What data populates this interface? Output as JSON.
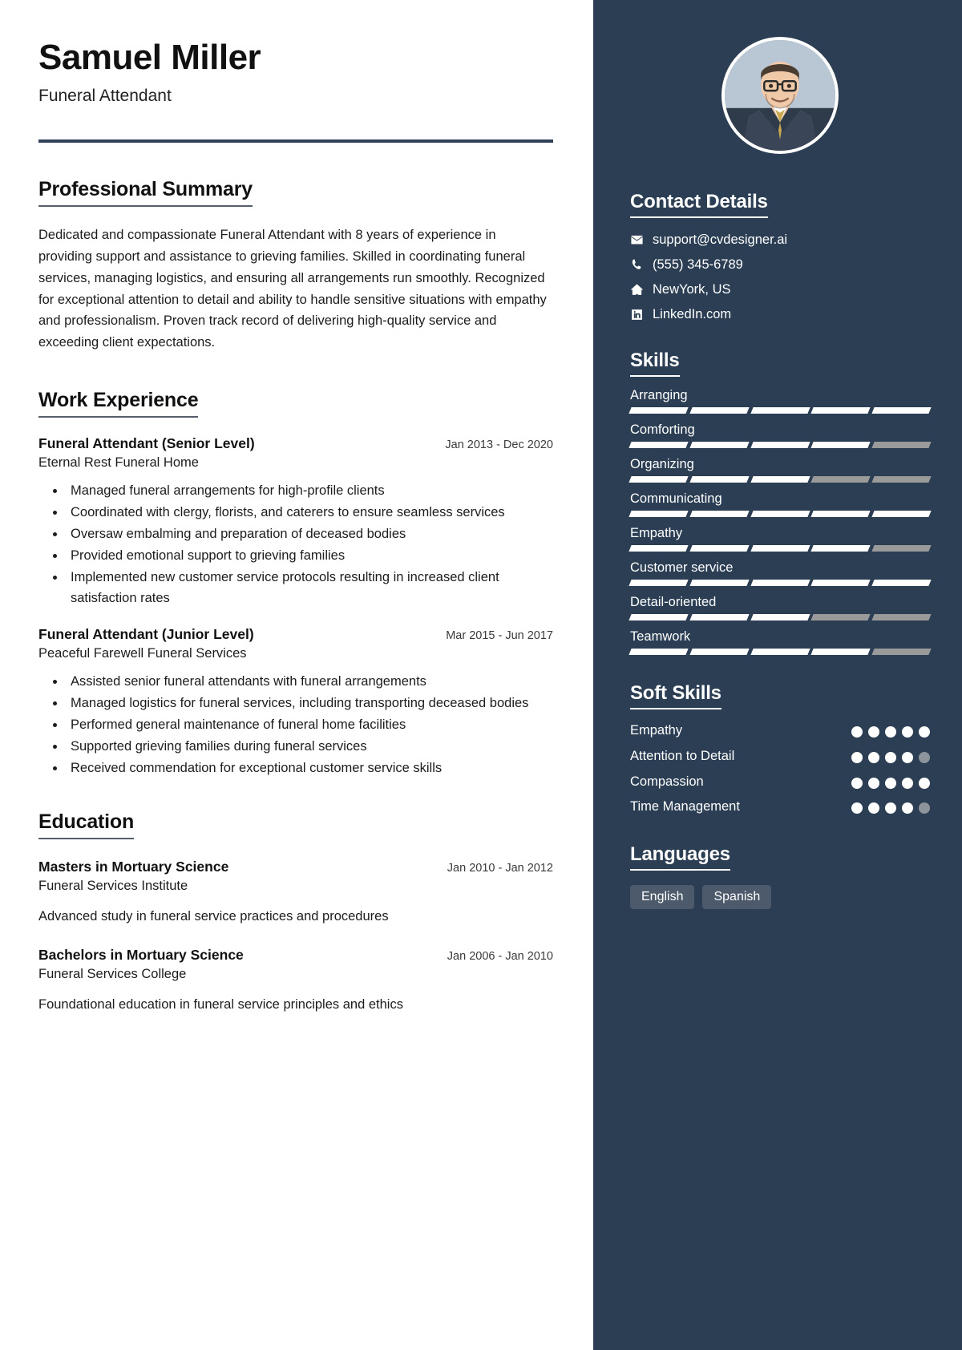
{
  "header": {
    "name": "Samuel Miller",
    "job_title": "Funeral Attendant"
  },
  "summary": {
    "heading": "Professional Summary",
    "text": "Dedicated and compassionate Funeral Attendant with 8 years of experience in providing support and assistance to grieving families. Skilled in coordinating funeral services, managing logistics, and ensuring all arrangements run smoothly. Recognized for exceptional attention to detail and ability to handle sensitive situations with empathy and professionalism. Proven track record of delivering high-quality service and exceeding client expectations."
  },
  "work": {
    "heading": "Work Experience",
    "entries": [
      {
        "role": "Funeral Attendant (Senior Level)",
        "date": "Jan 2013 - Dec 2020",
        "org": "Eternal Rest Funeral Home",
        "bullets": [
          "Managed funeral arrangements for high-profile clients",
          "Coordinated with clergy, florists, and caterers to ensure seamless services",
          "Oversaw embalming and preparation of deceased bodies",
          "Provided emotional support to grieving families",
          "Implemented new customer service protocols resulting in increased client satisfaction rates"
        ]
      },
      {
        "role": "Funeral Attendant (Junior Level)",
        "date": "Mar 2015 - Jun 2017",
        "org": "Peaceful Farewell Funeral Services",
        "bullets": [
          "Assisted senior funeral attendants with funeral arrangements",
          "Managed logistics for funeral services, including transporting deceased bodies",
          "Performed general maintenance of funeral home facilities",
          "Supported grieving families during funeral services",
          "Received commendation for exceptional customer service skills"
        ]
      }
    ]
  },
  "education": {
    "heading": "Education",
    "entries": [
      {
        "degree": "Masters in Mortuary Science",
        "date": "Jan 2010 - Jan 2012",
        "school": "Funeral Services Institute",
        "description": "Advanced study in funeral service practices and procedures"
      },
      {
        "degree": "Bachelors in Mortuary Science",
        "date": "Jan 2006 - Jan 2010",
        "school": "Funeral Services College",
        "description": "Foundational education in funeral service principles and ethics"
      }
    ]
  },
  "sidebar": {
    "avatar_alt": "profile-photo",
    "contact": {
      "heading": "Contact Details",
      "items": [
        {
          "icon": "envelope-icon",
          "value": "support@cvdesigner.ai"
        },
        {
          "icon": "phone-icon",
          "value": "(555) 345-6789"
        },
        {
          "icon": "home-icon",
          "value": "NewYork, US"
        },
        {
          "icon": "linkedin-icon",
          "value": "LinkedIn.com"
        }
      ]
    },
    "skills": {
      "heading": "Skills",
      "total_segments": 5,
      "items": [
        {
          "label": "Arranging",
          "filled": 5
        },
        {
          "label": "Comforting",
          "filled": 4
        },
        {
          "label": "Organizing",
          "filled": 3
        },
        {
          "label": "Communicating",
          "filled": 5
        },
        {
          "label": "Empathy",
          "filled": 4
        },
        {
          "label": "Customer service",
          "filled": 5
        },
        {
          "label": "Detail-oriented",
          "filled": 3
        },
        {
          "label": "Teamwork",
          "filled": 4
        }
      ]
    },
    "soft_skills": {
      "heading": "Soft Skills",
      "total_dots": 5,
      "items": [
        {
          "label": "Empathy",
          "filled": 5
        },
        {
          "label": "Attention to Detail",
          "filled": 4
        },
        {
          "label": "Compassion",
          "filled": 5
        },
        {
          "label": "Time Management",
          "filled": 4
        }
      ]
    },
    "languages": {
      "heading": "Languages",
      "items": [
        "English",
        "Spanish"
      ]
    }
  },
  "colors": {
    "sidebar_bg": "#2b3e53",
    "rule": "#2e4158",
    "chip_bg": "#4c5a6b",
    "segment_on": "#ffffff",
    "segment_off": "#9a9a9a"
  }
}
